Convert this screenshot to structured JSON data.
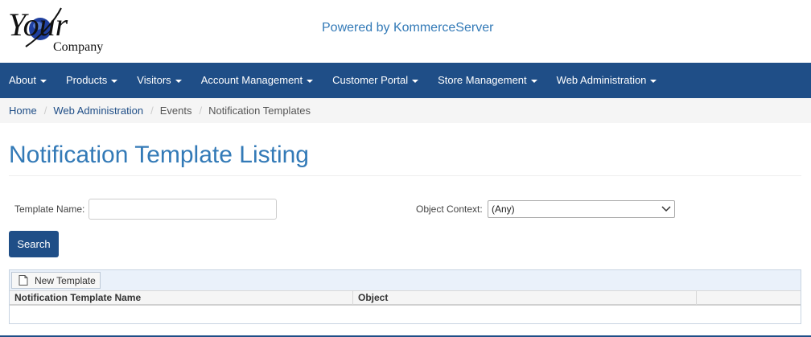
{
  "header": {
    "logo": {
      "word1": "Your",
      "word2": "Company"
    },
    "powered_by": "Powered by KommerceServer"
  },
  "nav": {
    "items": [
      {
        "label": "About"
      },
      {
        "label": "Products"
      },
      {
        "label": "Visitors"
      },
      {
        "label": "Account Management"
      },
      {
        "label": "Customer Portal"
      },
      {
        "label": "Store Management"
      },
      {
        "label": "Web Administration"
      }
    ]
  },
  "breadcrumb": {
    "items": [
      {
        "label": "Home"
      },
      {
        "label": "Web Administration"
      },
      {
        "label": "Events"
      },
      {
        "label": "Notification Templates"
      }
    ],
    "separator": "/"
  },
  "page": {
    "title": "Notification Template Listing"
  },
  "form": {
    "template_name_label": "Template Name:",
    "template_name_value": "",
    "object_context_label": "Object Context:",
    "object_context_value": "(Any)",
    "search_label": "Search"
  },
  "grid": {
    "new_template_label": "New Template",
    "columns": [
      "Notification Template Name",
      "Object",
      ""
    ]
  },
  "colors": {
    "nav_bg": "#1f4e87",
    "accent": "#337ab7"
  }
}
